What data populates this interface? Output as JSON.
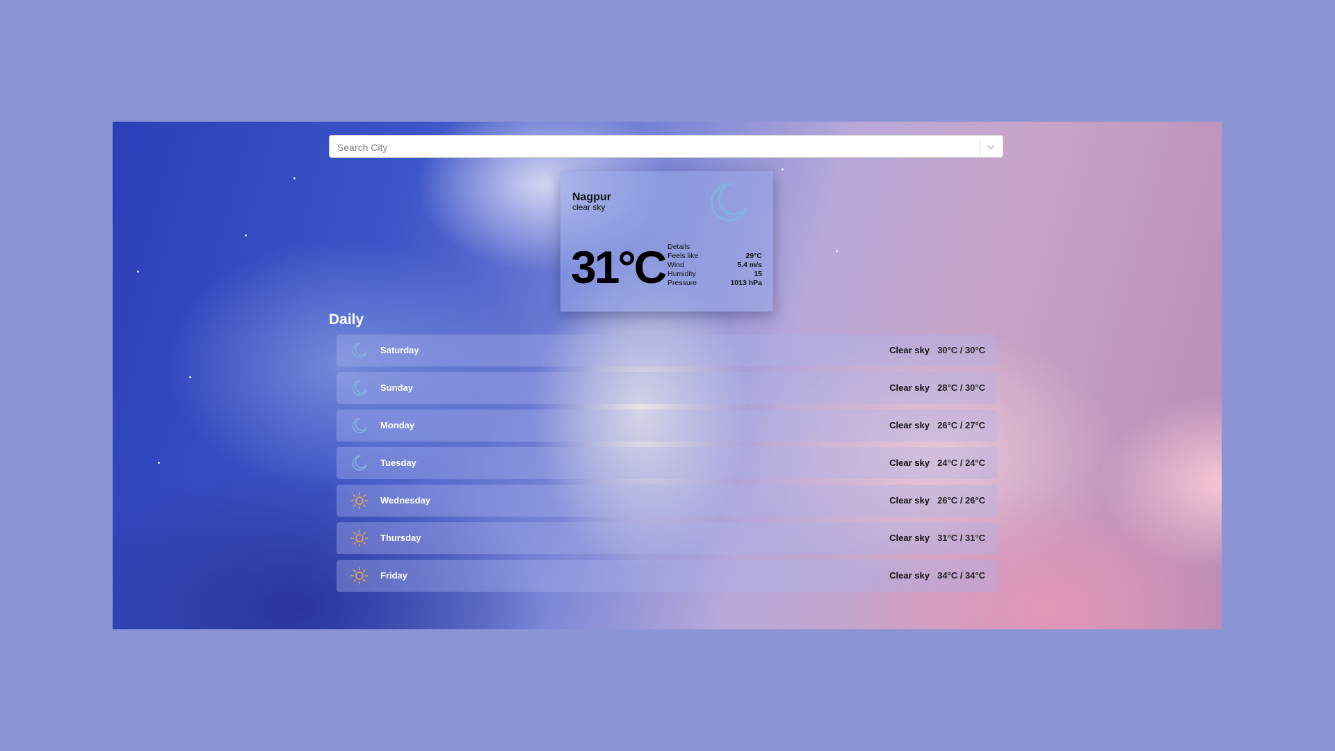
{
  "search": {
    "placeholder": "Search City"
  },
  "current": {
    "city": "Nagpur",
    "description": "clear sky",
    "temperature": "31°C",
    "icon": "moon-icon",
    "details_label": "Details",
    "details": [
      {
        "label": "Feels like",
        "value": "29°C"
      },
      {
        "label": "Wind",
        "value": "5.4 m/s"
      },
      {
        "label": "Humidity",
        "value": "15"
      },
      {
        "label": "Pressure",
        "value": "1013 hPa"
      }
    ]
  },
  "daily": {
    "title": "Daily",
    "days": [
      {
        "name": "Saturday",
        "condition": "Clear sky",
        "range": "30°C / 30°C",
        "icon": "moon-icon"
      },
      {
        "name": "Sunday",
        "condition": "Clear sky",
        "range": "28°C / 30°C",
        "icon": "moon-icon"
      },
      {
        "name": "Monday",
        "condition": "Clear sky",
        "range": "26°C / 27°C",
        "icon": "moon-icon"
      },
      {
        "name": "Tuesday",
        "condition": "Clear sky",
        "range": "24°C / 24°C",
        "icon": "moon-icon"
      },
      {
        "name": "Wednesday",
        "condition": "Clear sky",
        "range": "26°C / 26°C",
        "icon": "sun-icon"
      },
      {
        "name": "Thursday",
        "condition": "Clear sky",
        "range": "31°C / 31°C",
        "icon": "sun-icon"
      },
      {
        "name": "Friday",
        "condition": "Clear sky",
        "range": "34°C / 34°C",
        "icon": "sun-icon"
      }
    ]
  },
  "colors": {
    "page_background": "#8b94d4",
    "moon_icon": "#7fb3e0",
    "sun_icon": "#f2a33a"
  }
}
